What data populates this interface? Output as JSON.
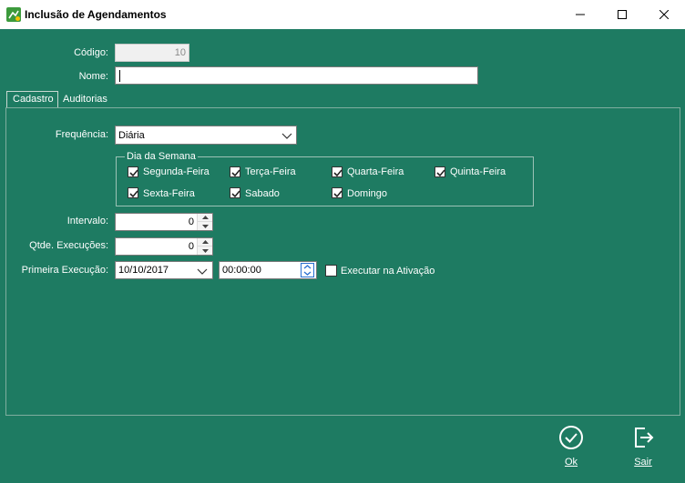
{
  "window": {
    "title": "Inclusão de Agendamentos"
  },
  "form": {
    "codigo_label": "Código:",
    "codigo_value": "10",
    "nome_label": "Nome:",
    "nome_value": ""
  },
  "tabs": [
    {
      "label": "Cadastro",
      "active": true
    },
    {
      "label": "Auditorias",
      "active": false
    }
  ],
  "cadastro": {
    "frequencia_label": "Frequência:",
    "frequencia_value": "Diária",
    "dia_semana_legend": "Dia da Semana",
    "days": [
      {
        "label": "Segunda-Feira",
        "checked": true
      },
      {
        "label": "Terça-Feira",
        "checked": true
      },
      {
        "label": "Quarta-Feira",
        "checked": true
      },
      {
        "label": "Quinta-Feira",
        "checked": true
      },
      {
        "label": "Sexta-Feira",
        "checked": true
      },
      {
        "label": "Sabado",
        "checked": true
      },
      {
        "label": "Domingo",
        "checked": true
      }
    ],
    "intervalo_label": "Intervalo:",
    "intervalo_value": "0",
    "qtde_label": "Qtde. Execuções:",
    "qtde_value": "0",
    "primeira_label": "Primeira Execução:",
    "primeira_date": "10/10/2017",
    "primeira_time": "00:00:00",
    "executar_label": "Executar na Ativação",
    "executar_checked": false
  },
  "actions": {
    "ok_label": "Ok",
    "sair_label": "Sair"
  },
  "colors": {
    "background": "#1e7b62",
    "titlebar": "#ffffff"
  }
}
